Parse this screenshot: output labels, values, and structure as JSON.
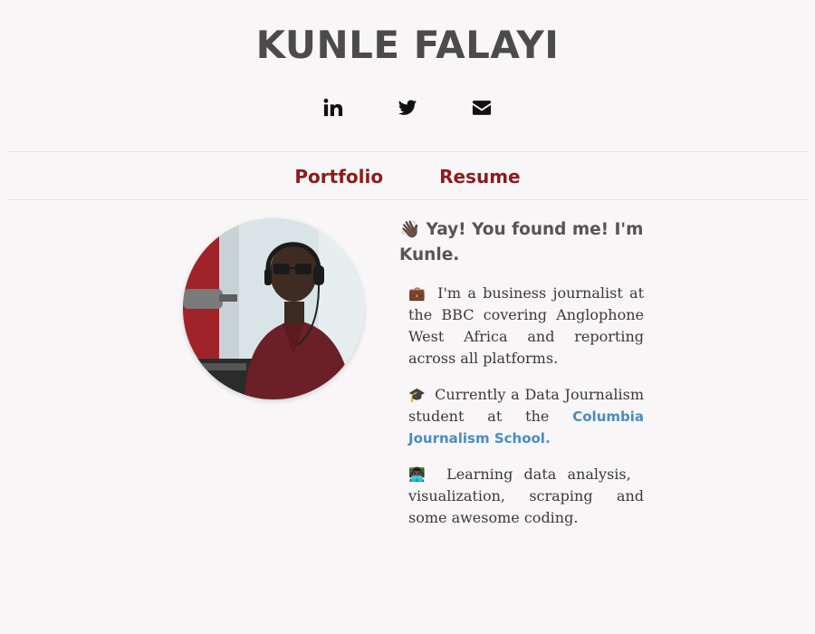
{
  "header": {
    "title": "KUNLE FALAYI"
  },
  "social": [
    {
      "name": "linkedin-icon"
    },
    {
      "name": "twitter-icon"
    },
    {
      "name": "envelope-icon"
    }
  ],
  "nav": {
    "portfolio": "Portfolio",
    "resume": "Resume"
  },
  "profile": {
    "avatar_icon": "profile-photo",
    "greeting_emoji": "👋🏿",
    "greeting": "Yay! You found me! I'm Kunle.",
    "bio": [
      {
        "emoji": "💼",
        "text": "I'm a business journalist at the BBC covering Anglophone West Africa and reporting across all platforms."
      },
      {
        "emoji": "🎓",
        "text": "Currently a Data Journalism student at the",
        "link": "Columbia Journalism School."
      },
      {
        "emoji": "👨🏿‍💻",
        "text": "Learning data analysis, visualization, scraping and some awesome coding."
      }
    ]
  },
  "colors": {
    "background": "#f8f6f7",
    "title": "#4b4b4b",
    "nav_link": "#8e1b1b",
    "link": "#4a8cc4"
  }
}
